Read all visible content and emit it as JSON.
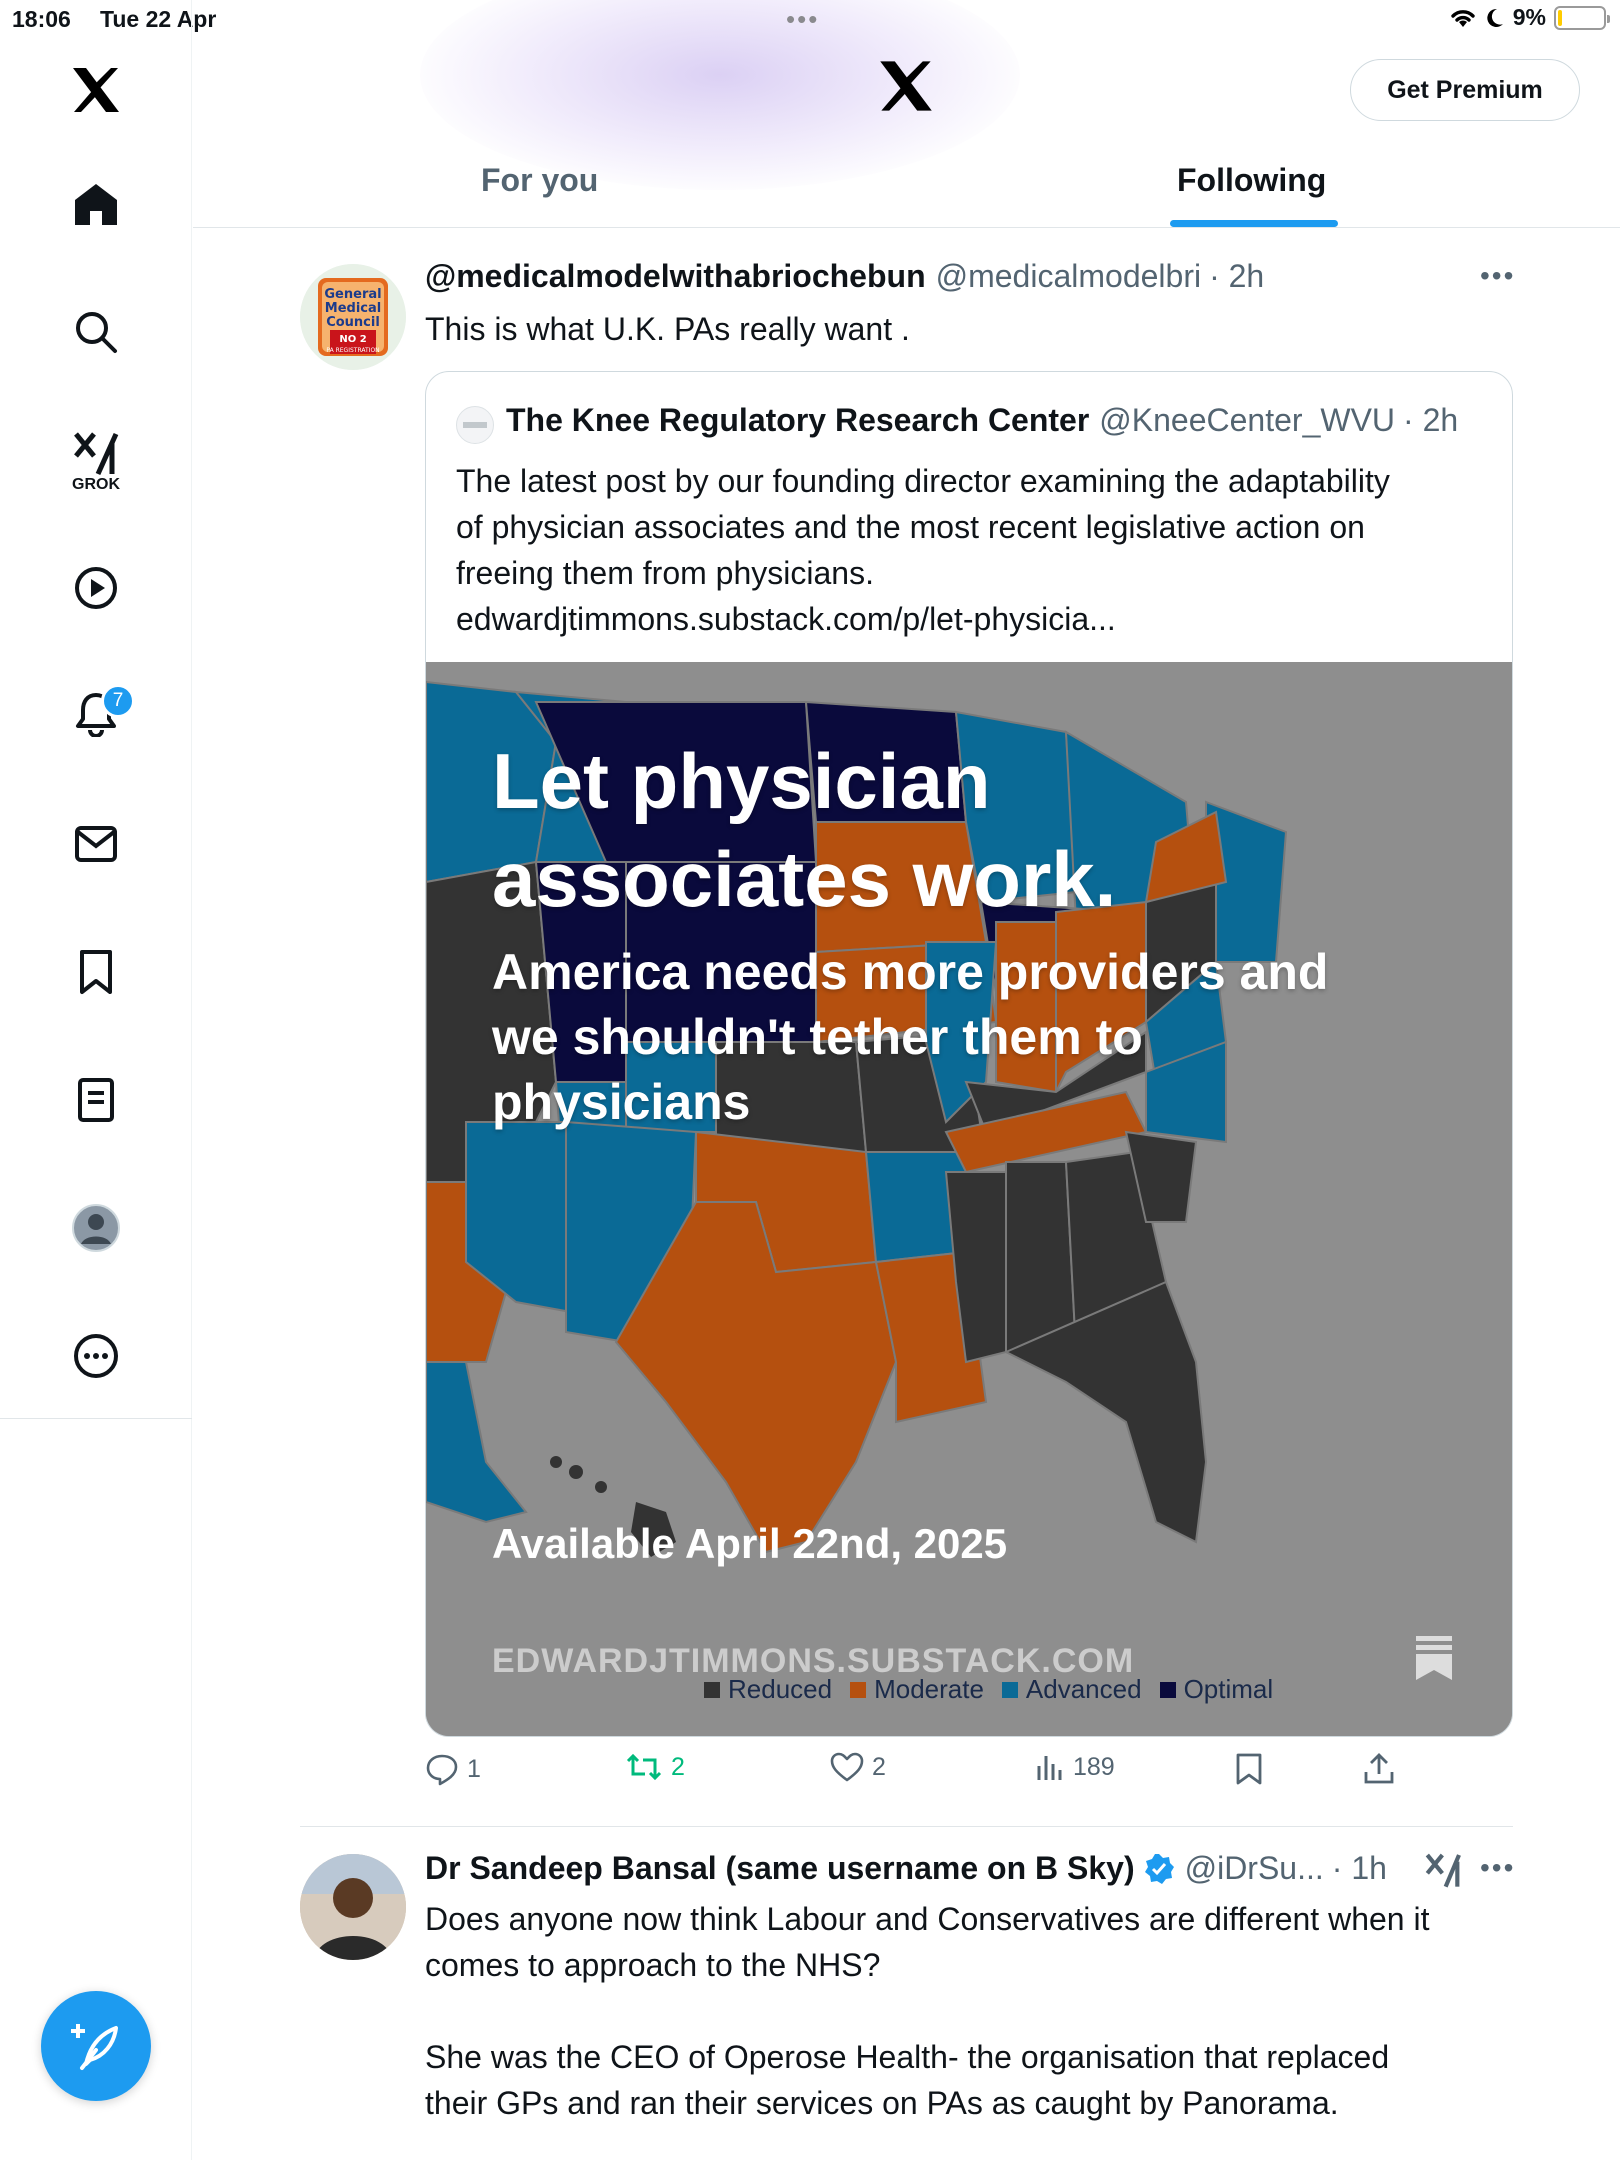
{
  "status_bar": {
    "time": "18:06",
    "date": "Tue 22 Apr",
    "battery": "9%",
    "battery_level": 0.09
  },
  "sidebar": {
    "items": [
      {
        "name": "x-logo-icon"
      },
      {
        "name": "home-icon"
      },
      {
        "name": "search-icon"
      },
      {
        "name": "grok-icon",
        "label": "GROK"
      },
      {
        "name": "video-icon"
      },
      {
        "name": "notifications-icon",
        "badge": "7"
      },
      {
        "name": "messages-icon"
      },
      {
        "name": "bookmarks-icon"
      },
      {
        "name": "lists-icon"
      },
      {
        "name": "profile-icon"
      },
      {
        "name": "more-icon"
      }
    ],
    "compose": "compose-icon"
  },
  "header": {
    "premium_label": "Get Premium",
    "tabs": [
      {
        "label": "For you",
        "active": false
      },
      {
        "label": "Following",
        "active": true
      }
    ]
  },
  "tweets": [
    {
      "display_name": "@medicalmodelwithabriochebun",
      "handle": "@medicalmodelbri",
      "time": "· 2h",
      "text": "This is what U.K. PAs really want .",
      "avatar_lines": [
        "General",
        "Medical",
        "Council",
        "NO 2",
        "PA REGISTRATION"
      ],
      "quote": {
        "display_name": "The Knee Regulatory Research Center",
        "handle": "@KneeCenter_WVU",
        "time": "· 2h",
        "text_lines": [
          "The latest post by our founding director examining the adaptability",
          "of physician associates and the most recent legislative action on",
          "freeing them from physicians.",
          "edwardjtimmons.substack.com/p/let-physicia..."
        ],
        "image": {
          "title_lines": [
            "Let physician",
            "associates work."
          ],
          "subtitle_lines": [
            "America needs more providers and",
            "we shouldn't tether them to",
            "physicians"
          ],
          "available": "Available April 22nd, 2025",
          "domain": "EDWARDJTIMMONS.SUBSTACK.COM",
          "legend": [
            {
              "label": "Reduced",
              "color": "#333333"
            },
            {
              "label": "Moderate",
              "color": "#b5500f"
            },
            {
              "label": "Advanced",
              "color": "#0a6a96"
            },
            {
              "label": "Optimal",
              "color": "#0a0a3c"
            }
          ]
        }
      },
      "stats": {
        "replies": "1",
        "reposts": "2",
        "likes": "2",
        "views": "189"
      }
    },
    {
      "display_name": "Dr Sandeep Bansal (same username on B Sky)",
      "handle": "@iDrSu...",
      "time": "· 1h",
      "verified": true,
      "text_lines": [
        "Does anyone now think Labour and Conservatives are different when it",
        "comes to approach to the NHS?",
        "",
        "She was the CEO of Operose Health- the organisation that replaced",
        "their GPs and ran their services on PAs as caught by Panorama."
      ]
    }
  ],
  "colors": {
    "accent": "#1d9bf0",
    "repost_active": "#00ba7c",
    "map_reduced": "#333333",
    "map_moderate": "#b5500f",
    "map_advanced": "#0a6a96",
    "map_optimal": "#0a0a3c"
  }
}
